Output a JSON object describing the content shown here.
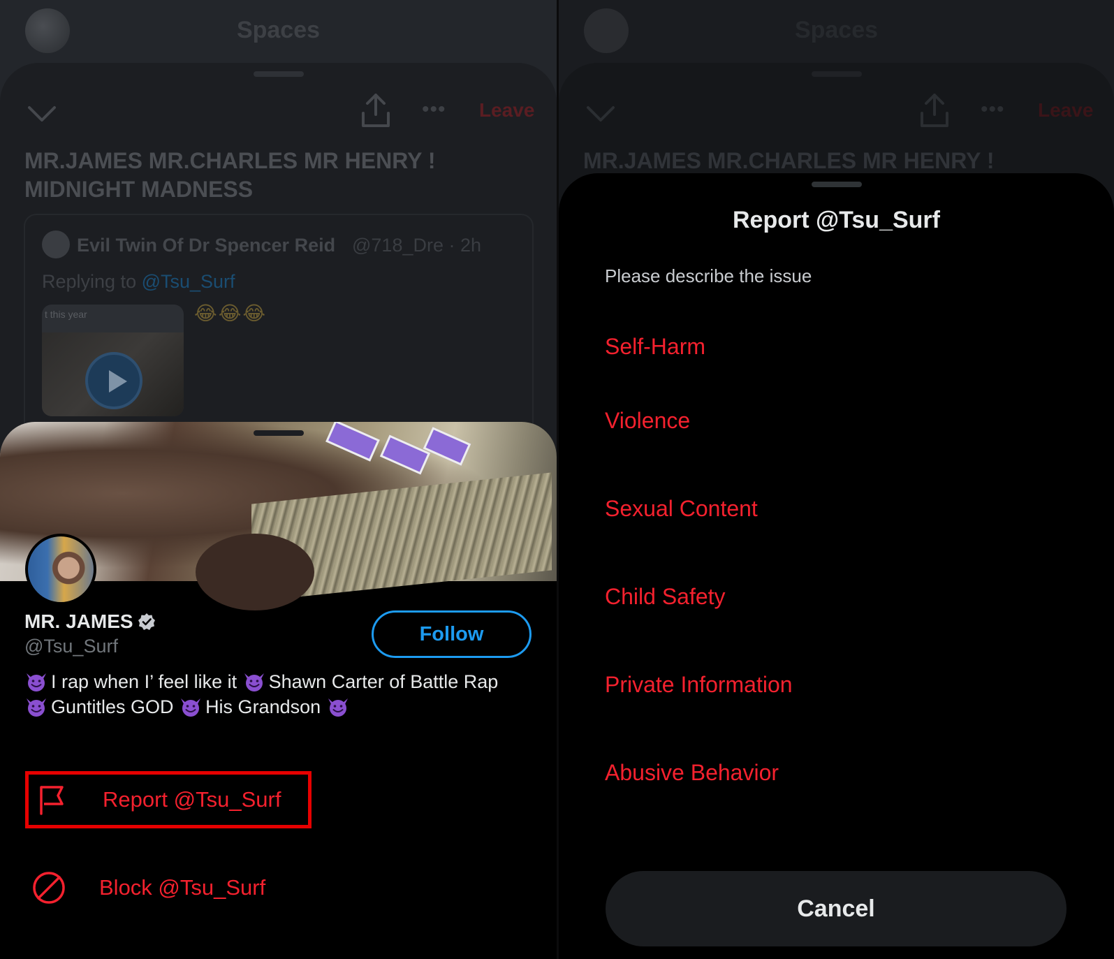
{
  "spaces": {
    "header_title": "Spaces",
    "leave_label": "Leave",
    "more_label": "•••",
    "space_title": "MR.JAMES MR.CHARLES MR HENRY ! MIDNIGHT MADNESS",
    "space_title_short": "MR.JAMES MR.CHARLES MR HENRY !",
    "tweet": {
      "author_name": "Evil Twin Of Dr Spencer Reid",
      "author_handle_time": "@718_Dre · 2h",
      "replying_prefix": "Replying to ",
      "replying_handle": "@Tsu_Surf",
      "video_caption": "t this year",
      "emoji": "😂😂😂"
    }
  },
  "profile": {
    "name": "MR. JAMES",
    "handle": "@Tsu_Surf",
    "follow_label": "Follow",
    "bio_parts": [
      "I rap when I’ feel like it ",
      "Shawn Carter of Battle Rap",
      "Guntitles GOD ",
      "His Grandson "
    ],
    "actions": {
      "report_label": "Report @Tsu_Surf",
      "block_label": "Block @Tsu_Surf"
    }
  },
  "report": {
    "title": "Report @Tsu_Surf",
    "subtitle": "Please describe the issue",
    "options": [
      "Self-Harm",
      "Violence",
      "Sexual Content",
      "Child Safety",
      "Private Information",
      "Abusive Behavior"
    ],
    "cancel_label": "Cancel"
  },
  "colors": {
    "danger": "#f4212e",
    "accent": "#1d9bf0",
    "highlight_box": "#e60000",
    "sheet_bg": "#000000"
  },
  "icons": {
    "collapse": "chevron-down-icon",
    "share": "share-icon",
    "more": "more-icon",
    "verified": "verified-badge-icon",
    "report": "flag-icon",
    "block": "block-icon",
    "play": "play-icon",
    "devil": "smiling-devil-emoji"
  }
}
